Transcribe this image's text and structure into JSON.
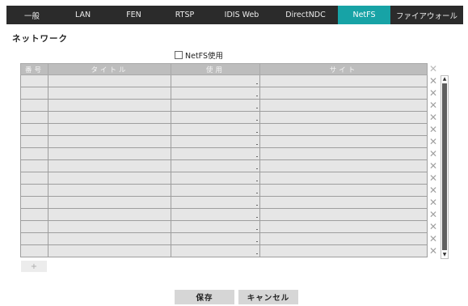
{
  "tabs": [
    {
      "label": "一般",
      "active": false
    },
    {
      "label": "LAN",
      "active": false
    },
    {
      "label": "FEN",
      "active": false
    },
    {
      "label": "RTSP",
      "active": false
    },
    {
      "label": "IDIS Web",
      "active": false
    },
    {
      "label": "DirectNDC",
      "active": false
    },
    {
      "label": "NetFS",
      "active": true
    },
    {
      "label": "ファイアウォール",
      "active": false
    }
  ],
  "section_title": "ネットワーク",
  "netfs_checkbox": {
    "label": "NetFS使用",
    "checked": false
  },
  "table": {
    "headers": [
      "番号",
      "タイトル",
      "使用",
      "サイト"
    ],
    "delete_header_icon": "close-icon",
    "row_count": 15
  },
  "add_button": {
    "label": "+"
  },
  "footer": {
    "save_label": "保存",
    "cancel_label": "キャンセル"
  },
  "colors": {
    "tab_bar": "#2b2b2b",
    "tab_active": "#17a3a6",
    "header_bg": "#bdbdbd",
    "row_bg": "#e6e6e6"
  }
}
